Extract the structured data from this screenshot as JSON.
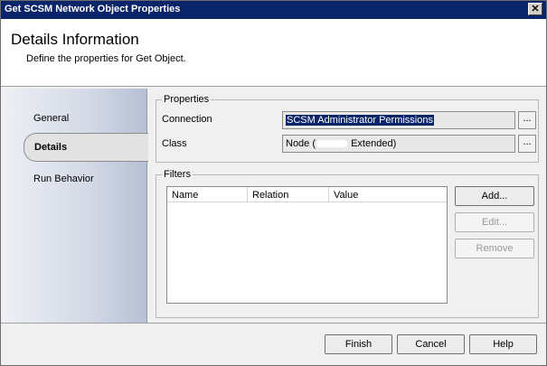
{
  "window": {
    "title": "Get SCSM Network  Object Properties",
    "close_glyph": "✕"
  },
  "header": {
    "title": "Details Information",
    "subtitle": "Define the properties for Get Object."
  },
  "sidebar": {
    "items": [
      {
        "label": "General"
      },
      {
        "label": "Details"
      },
      {
        "label": "Run Behavior"
      }
    ]
  },
  "properties": {
    "legend": "Properties",
    "connection_label": "Connection",
    "connection_value": "SCSM Administrator Permissions",
    "class_label": "Class",
    "class_value_prefix": "Node (",
    "class_value_suffix": " Extended)",
    "browse_glyph": "..."
  },
  "filters": {
    "legend": "Filters",
    "columns": [
      "Name",
      "Relation",
      "Value"
    ],
    "rows": [],
    "add_label": "Add...",
    "edit_label": "Edit...",
    "remove_label": "Remove"
  },
  "footer": {
    "finish_label": "Finish",
    "cancel_label": "Cancel",
    "help_label": "Help"
  }
}
